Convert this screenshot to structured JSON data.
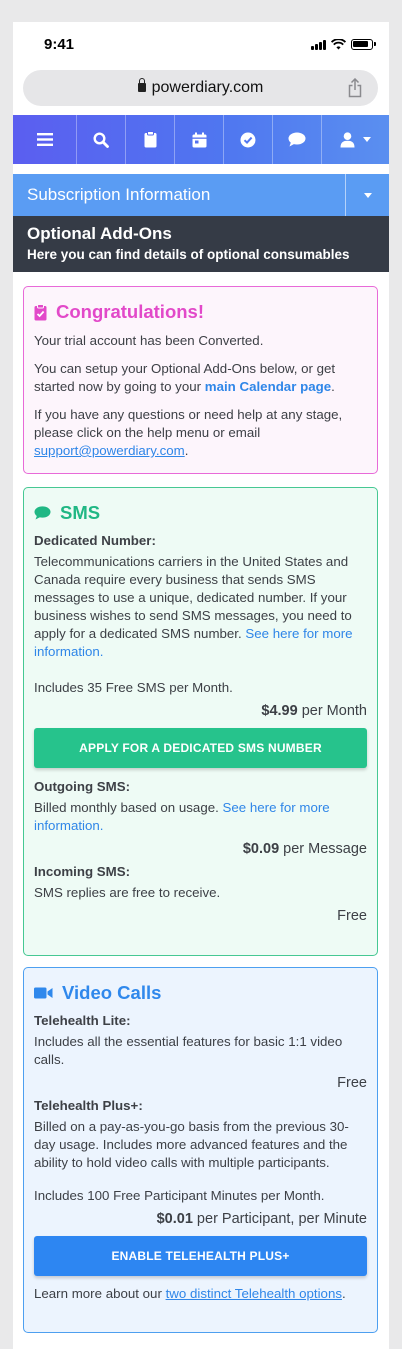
{
  "status_bar": {
    "time": "9:41"
  },
  "browser": {
    "url": "powerdiary.com"
  },
  "nav": {
    "items": [
      "menu-icon",
      "search-icon",
      "clipboard-icon",
      "calendar-icon",
      "check-circle-icon",
      "chat-icon",
      "user-icon"
    ]
  },
  "subscription_dropdown": {
    "label": "Subscription Information"
  },
  "page_header": {
    "title": "Optional Add-Ons",
    "subtitle": "Here you can find details of optional consumables"
  },
  "congrats": {
    "title": "Congratulations!",
    "p1": "Your trial account has been Converted.",
    "p2_text": "You can setup your Optional Add-Ons below, or get started now by going to your ",
    "p2_link": "main Calendar page",
    "p2_end": ".",
    "p3_text": "If you have any questions or need help at any stage, please click on the help menu or email ",
    "p3_link": "support@powerdiary.com",
    "p3_end": "."
  },
  "sms": {
    "title": "SMS",
    "dedicated_heading": "Dedicated Number:",
    "dedicated_text": "Telecommunications carriers in the United States and Canada require every business that sends SMS messages to use a unique, dedicated number. If your business wishes to send SMS messages, you need to apply for a dedicated SMS number. ",
    "dedicated_link": "See here for more information.",
    "includes": "Includes 35 Free SMS per Month.",
    "dedicated_price": "$4.99",
    "dedicated_unit": " per Month",
    "apply_button": "APPLY FOR A DEDICATED SMS NUMBER",
    "outgoing_heading": "Outgoing SMS:",
    "outgoing_text": "Billed monthly based on usage. ",
    "outgoing_link": "See here for more information.",
    "outgoing_price": "$0.09",
    "outgoing_unit": " per Message",
    "incoming_heading": "Incoming SMS:",
    "incoming_text": "SMS replies are free to receive.",
    "incoming_price": "Free"
  },
  "video": {
    "title": "Video Calls",
    "lite_heading": "Telehealth Lite:",
    "lite_text": "Includes all the essential features for basic 1:1 video calls.",
    "lite_price": "Free",
    "plus_heading": "Telehealth Plus+:",
    "plus_text": "Billed on a pay-as-you-go basis from the previous 30-day usage. Includes more advanced features and the ability to hold video calls with multiple participants.",
    "plus_includes": "Includes 100 Free Participant Minutes per Month.",
    "plus_price": "$0.01",
    "plus_unit": " per Participant, per Minute",
    "enable_button": "ENABLE TELEHEALTH PLUS+",
    "learn_text": "Learn more about our ",
    "learn_link": "two distinct Telehealth options",
    "learn_end": "."
  },
  "colors": {
    "nav_gradient_start": "#5b5ef0",
    "subbar": "#5a9cf3",
    "header": "#353b46",
    "congrats_accent": "#e249c9",
    "sms_accent": "#20b784",
    "video_accent": "#2f88ec",
    "link": "#2f86e8"
  }
}
